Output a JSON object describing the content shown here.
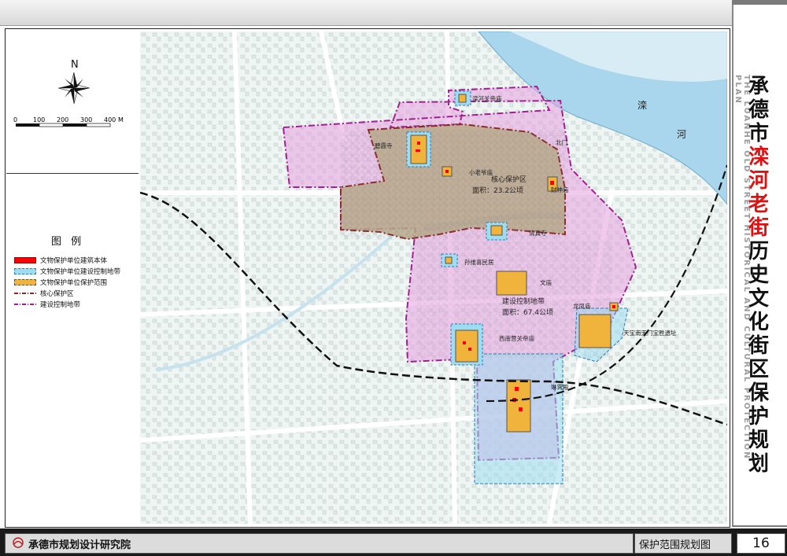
{
  "title": {
    "prefix": "承德市",
    "highlight": "滦河老街",
    "suffix": "历史文化街区保护规划",
    "english": "THE LUANHE OLD STREET HISTORICAL AND CULTURAL PROTECTION PLAN"
  },
  "compass_label": "N",
  "scale_bar": {
    "ticks": [
      "0",
      "100",
      "200",
      "300",
      "400"
    ],
    "unit": "M"
  },
  "legend": {
    "title": "图 例",
    "items": [
      {
        "label": "文物保护单位建筑本体",
        "color": "#ff0000"
      },
      {
        "label": "文物保护单位建设控制地带",
        "color": "#9fdcf0"
      },
      {
        "label": "文物保护单位保护范围",
        "color": "#f0b43c"
      },
      {
        "label": "核心保护区",
        "color": "#8b2a2a"
      },
      {
        "label": "建设控制地带",
        "color": "#a0208f"
      }
    ]
  },
  "map": {
    "river_label_1": "滦",
    "river_label_2": "河",
    "core_area": {
      "label": "核心保护区",
      "area": "面积：23.2公顷"
    },
    "control_area": {
      "label": "建设控制地带",
      "area": "面积：67.4公顷"
    },
    "sites": [
      "滦河关帝庙",
      "碧霞寺",
      "小老爷庙",
      "北门",
      "财神庙",
      "清真寺",
      "孙维喜民居",
      "文庙",
      "龙凤庙",
      "西南营关帝庙",
      "天宝南天门宝胜遗址",
      "琳霄殿"
    ]
  },
  "footer": {
    "organization": "承德市规划设计研究院",
    "drawing_name": "保护范围规划图",
    "page_number": "16"
  }
}
